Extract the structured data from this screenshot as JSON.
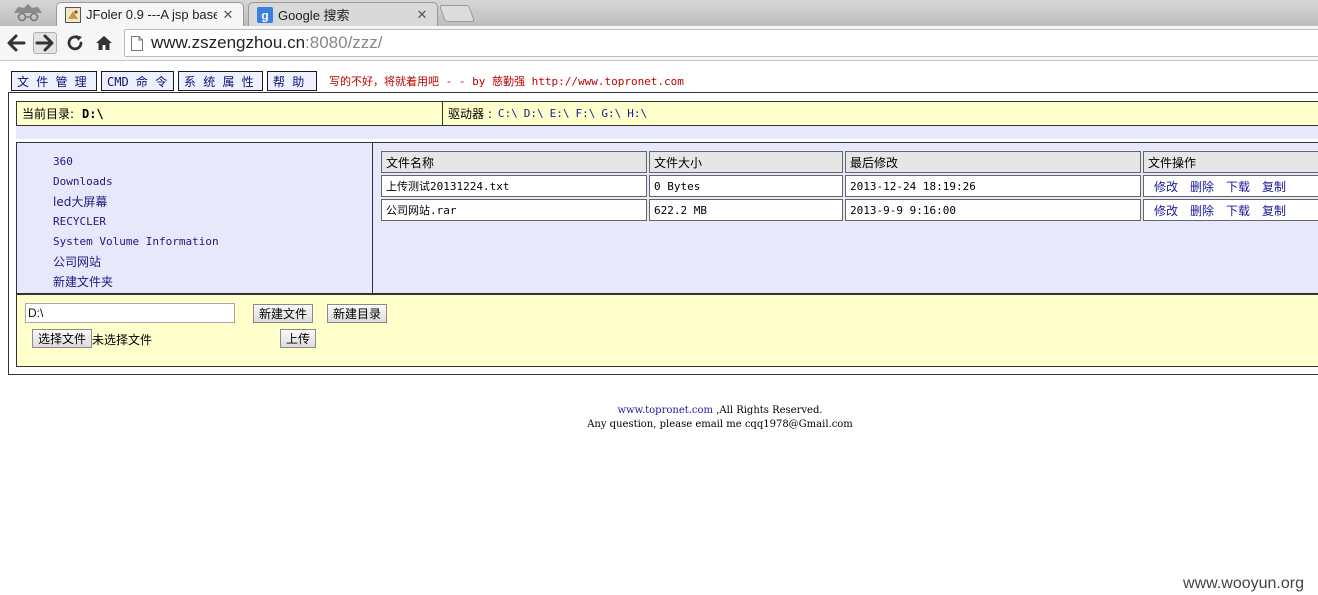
{
  "browser": {
    "tabs": [
      {
        "title": "JFoler 0.9 ---A jsp base",
        "active": true
      },
      {
        "title": "Google 搜索",
        "active": false
      }
    ],
    "url_host": "www.zszengzhou.cn",
    "url_rest": ":8080/zzz/"
  },
  "menu": {
    "items": [
      "文 件 管 理",
      "CMD 命 令",
      "系 统 属 性",
      "帮 助"
    ],
    "tagline": "写的不好，将就着用吧 - - by 慈勤强 http://www.topronet.com"
  },
  "dir": {
    "label": "当前目录:",
    "current": "D:\\",
    "drives_label": "驱动器 :",
    "drives": [
      "C:\\",
      "D:\\",
      "E:\\",
      "F:\\",
      "G:\\",
      "H:\\"
    ]
  },
  "tree": {
    "items": [
      "360",
      "Downloads",
      "led大屏幕",
      "RECYCLER",
      "System Volume Information",
      "公司网站",
      "新建文件夹"
    ]
  },
  "files": {
    "headers": [
      "文件名称",
      "文件大小",
      "最后修改",
      "文件操作"
    ],
    "rows": [
      {
        "name": "上传测试20131224.txt",
        "size": "0 Bytes",
        "modified": "2013-12-24 18:19:26"
      },
      {
        "name": "公司网站.rar",
        "size": "622.2 MB",
        "modified": "2013-9-9 9:16:00"
      }
    ],
    "ops": [
      "修改",
      "删除",
      "下载",
      "复制"
    ]
  },
  "actions": {
    "path_value": "D:\\",
    "new_file": "新建文件",
    "new_dir": "新建目录",
    "choose_file": "选择文件",
    "no_file": "未选择文件",
    "upload": "上传"
  },
  "footer": {
    "site": "www.topronet.com",
    "rights": " ,All Rights Reserved.",
    "line2": "Any question, please email me cqq1978@Gmail.com"
  },
  "watermark": "www.wooyun.org"
}
